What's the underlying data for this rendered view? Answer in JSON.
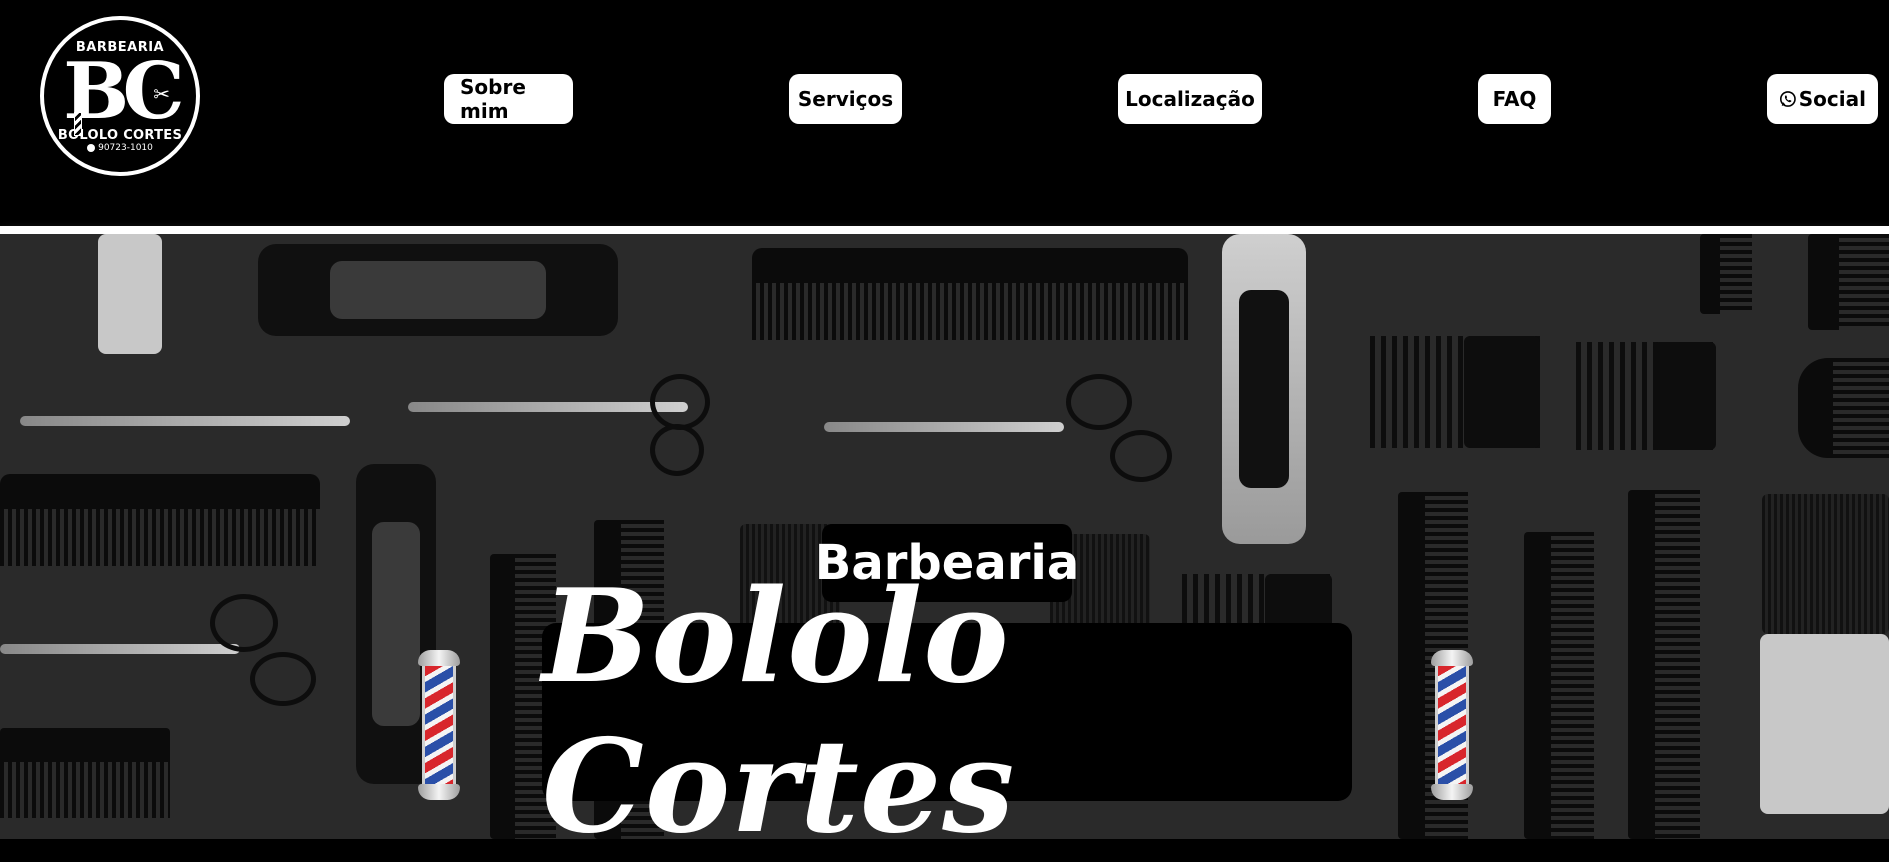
{
  "logo": {
    "top_text": "BARBEARIA",
    "monogram": "BC",
    "bottom_text": "BOLOLO CORTES",
    "phone": "90723-1010",
    "icons": [
      "scissors-icon",
      "barber-pole-icon",
      "whatsapp-icon"
    ]
  },
  "nav": {
    "items": [
      {
        "label": "Sobre mim"
      },
      {
        "label": "Serviços"
      },
      {
        "label": "Localização"
      },
      {
        "label": "FAQ"
      },
      {
        "label": "Social",
        "icon": "whatsapp-icon"
      }
    ]
  },
  "hero": {
    "subtitle": "Barbearia",
    "title": "Bololo Cortes",
    "pole_icon": "barber-pole-icon",
    "pole_colors": [
      "#d8262c",
      "#f4f4f4",
      "#2a4fa8"
    ]
  },
  "colors": {
    "background": "#000000",
    "button_bg": "#ffffff",
    "button_text": "#000000",
    "hero_bg": "#2a2a2a"
  }
}
